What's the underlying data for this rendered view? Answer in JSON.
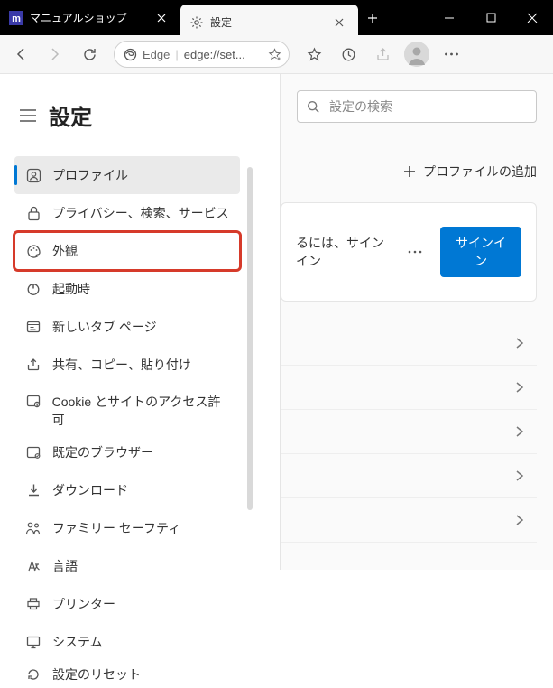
{
  "tabs": {
    "inactive": {
      "label": "マニュアルショップ"
    },
    "active": {
      "label": "設定"
    }
  },
  "toolbar": {
    "edge_label": "Edge",
    "url": "edge://set..."
  },
  "header": {
    "title": "設定"
  },
  "nav": [
    {
      "label": "プロファイル"
    },
    {
      "label": "プライバシー、検索、サービス"
    },
    {
      "label": "外観"
    },
    {
      "label": "起動時"
    },
    {
      "label": "新しいタブ ページ"
    },
    {
      "label": "共有、コピー、貼り付け"
    },
    {
      "label": "Cookie とサイトのアクセス許可"
    },
    {
      "label": "既定のブラウザー"
    },
    {
      "label": "ダウンロード"
    },
    {
      "label": "ファミリー セーフティ"
    },
    {
      "label": "言語"
    },
    {
      "label": "プリンター"
    },
    {
      "label": "システム"
    },
    {
      "label": "設定のリセット"
    }
  ],
  "right": {
    "search_placeholder": "設定の検索",
    "add_profile": "プロファイルの追加",
    "card_text": "るには、サインイン",
    "signin_btn": "サインイン"
  }
}
